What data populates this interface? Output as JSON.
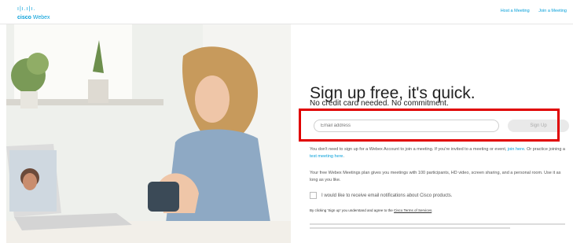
{
  "header": {
    "brand_top": "cisco",
    "brand_name": "Webex",
    "links": [
      "Host a Meeting",
      "Join a Meeting"
    ]
  },
  "signup": {
    "title": "Sign up free, it's quick.",
    "subtitle": "No credit card needed. No commitment.",
    "email_placeholder": "Email address",
    "button_label": "Sign Up"
  },
  "info": {
    "p1_text": "You don't need to sign up for a Webex Account to join a meeting. If you're invited to a meeting or event, ",
    "p1_link1": "join here",
    "p1_mid": ". Or practice joining a ",
    "p1_link2": "test meeting here",
    "p1_end": ".",
    "p2": "Your free Webex Meetings plan gives you meetings with 100 participants, HD video, screen sharing, and a personal room. Use it as long as you like.",
    "checkbox_label": "I would like to receive email notifications about Cisco products.",
    "terms_text": "By clicking 'Sign up' you understand and agree to the ",
    "terms_link": "Cisco Terms of Services",
    "terms_end": "."
  },
  "colors": {
    "brand": "#049fd9",
    "highlight": "#e00000",
    "button_bg": "#e9e9e9"
  }
}
